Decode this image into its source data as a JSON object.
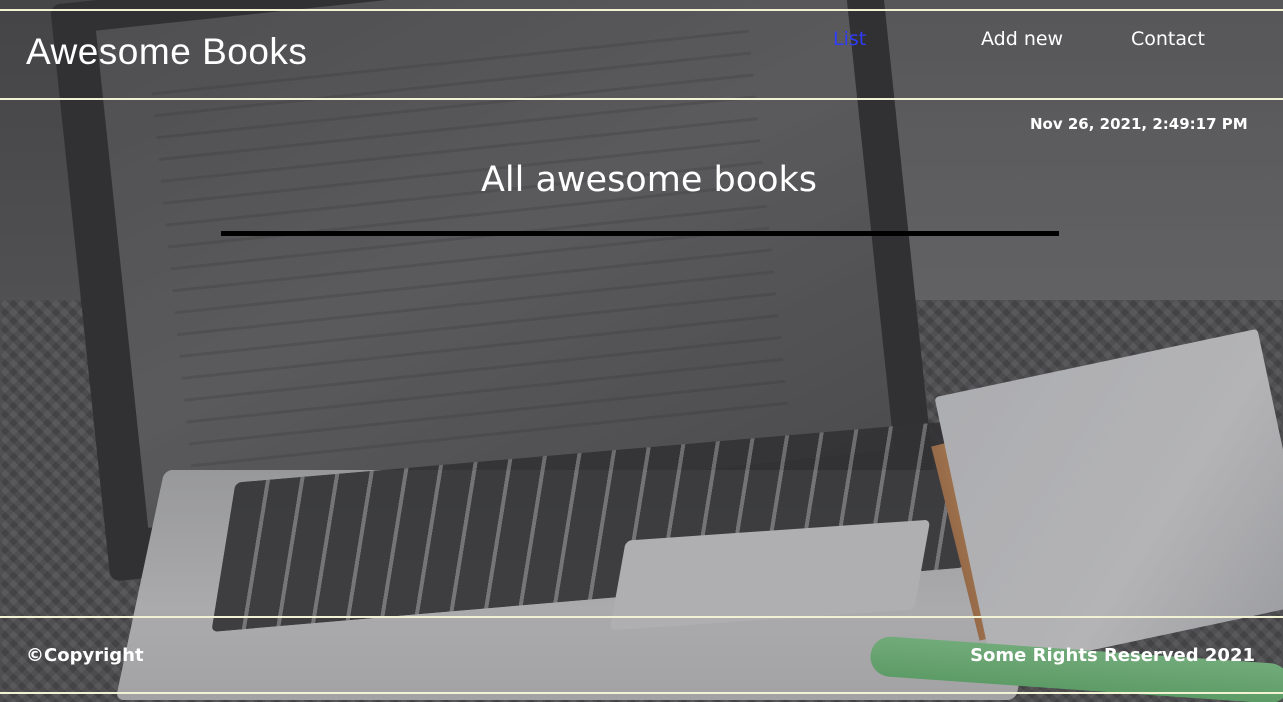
{
  "header": {
    "brand": "Awesome Books",
    "nav": [
      {
        "label": "List",
        "active": true
      },
      {
        "label": "Add new",
        "active": false
      },
      {
        "label": "Contact",
        "active": false
      }
    ]
  },
  "main": {
    "datetime": "Nov 26, 2021, 2:49:17 PM",
    "title": "All awesome books"
  },
  "footer": {
    "copyright": "©Copyright",
    "rights": "Some Rights Reserved 2021"
  },
  "colors": {
    "active_link": "#2f3cff",
    "border": "#f1f3d2",
    "divider": "#000000",
    "text": "#ffffff"
  }
}
